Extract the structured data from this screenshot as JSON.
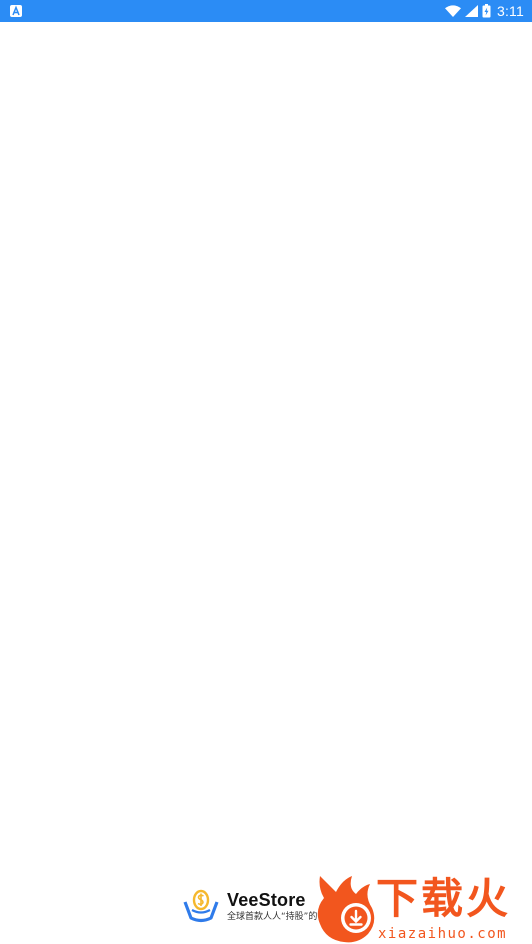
{
  "status_bar": {
    "time": "3:11",
    "background_color": "#2b8cf5",
    "icons": [
      "notification-a-icon",
      "wifi-icon",
      "cell-signal-icon",
      "battery-charging-icon"
    ]
  },
  "branding": {
    "app_name": "VeeStore",
    "tagline": "全球首款人人“持股”的",
    "logo_icon": "coin-basket-icon",
    "logo_colors": {
      "coin": "#f5b82e",
      "basket": "#2f7bea"
    }
  },
  "watermark": {
    "title": "下载火",
    "url": "xiazaihuo.com",
    "color": "#f2561e",
    "icon": "flame-download-icon"
  }
}
